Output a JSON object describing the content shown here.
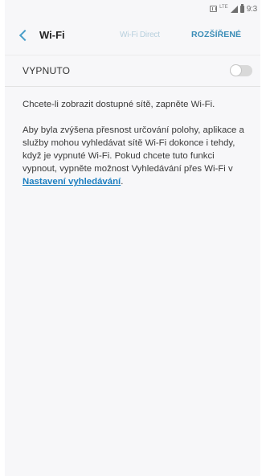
{
  "status_bar": {
    "network": "LTE",
    "time": "9:3"
  },
  "app_bar": {
    "title": "Wi-Fi",
    "tab_direct": "Wi-Fi Direct",
    "tab_advanced": "ROZŠÍŘENÉ"
  },
  "wifi_toggle": {
    "label": "VYPNUTO",
    "state": "off"
  },
  "content": {
    "paragraph1": "Chcete-li zobrazit dostupné sítě, zapněte Wi-Fi.",
    "paragraph2_text": "Aby byla zvýšena přesnost určování polohy, aplikace a služby mohou vyhledávat sítě Wi-Fi dokonce i tehdy, když je vypnuté Wi-Fi. Pokud chcete tuto funkci vypnout, vypněte možnost Vyhledávání přes Wi-Fi v ",
    "paragraph2_link": "Nastavení vyhledávání",
    "paragraph2_end": "."
  },
  "colors": {
    "accent": "#3b8db7",
    "link": "#1d7fc0",
    "marker": "#e0167f"
  }
}
